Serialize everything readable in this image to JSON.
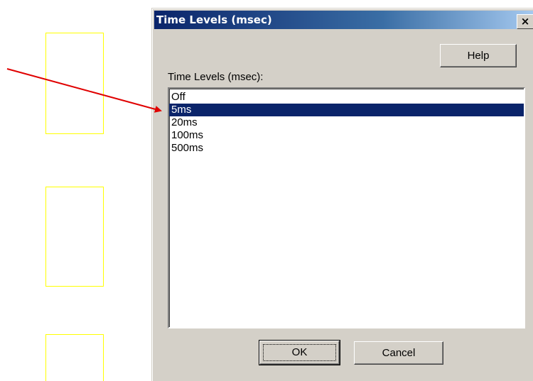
{
  "dialog": {
    "title": "Time Levels (msec)",
    "close_glyph": "×",
    "help_label": "Help",
    "list_label": "Time Levels (msec):",
    "items": [
      "Off",
      "5ms",
      "20ms",
      "100ms",
      "500ms"
    ],
    "selected_item": "5ms",
    "ok_label": "OK",
    "cancel_label": "Cancel"
  },
  "colors": {
    "title_bar": "#0a246a",
    "selection": "#0a246a",
    "dialog_bg": "#d4d0c8",
    "annotation_arrow": "#e00000",
    "outline_boxes": "#ffff00"
  }
}
